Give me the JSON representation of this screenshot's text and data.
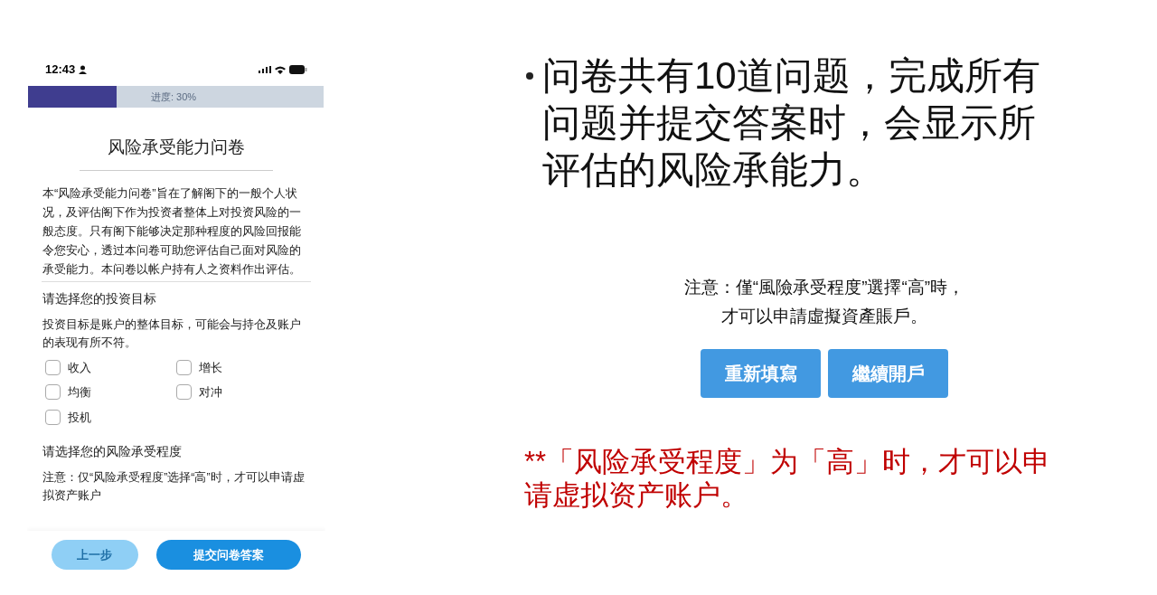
{
  "phone": {
    "status_bar": {
      "time": "12:43"
    },
    "progress": {
      "level": 0.3,
      "label": "进度: 30%"
    },
    "title": "风险承受能力问卷",
    "intro": "本“风险承受能力问卷”旨在了解阁下的一般个人状况，及评估阁下作为投资者整体上对投资风险的一般态度。只有阁下能够决定那种程度的风险回报能令您安心，透过本问卷可助您评估自己面对风险的承受能力。本问卷以帐户持有人之资料作出评估。",
    "sections": [
      {
        "heading": "请选择您的投资目标",
        "description": "投资目标是账户的整体目标，可能会与持仓及账户的表现有所不符。",
        "options": [
          {
            "label": "收入",
            "checked": false
          },
          {
            "label": "增长",
            "checked": false
          },
          {
            "label": "均衡",
            "checked": false
          },
          {
            "label": "对冲",
            "checked": false
          },
          {
            "label": "投机",
            "checked": false
          }
        ]
      },
      {
        "heading": "请选择您的风险承受程度",
        "description": "注意：仅“风险承受程度”选择“高”时，才可以申请虚拟资产账户"
      }
    ],
    "buttons": [
      {
        "label": "上一步",
        "disabled": true
      },
      {
        "label": "提交问卷答案",
        "disabled": false
      }
    ]
  },
  "slide": {
    "bullet": "问卷共有10道问题，完成所有问题并提交答案时，会显示所评估的风险承能力。",
    "notice_lines": [
      "注意：僅“風險承受程度”選擇“高”時，",
      "才可以申請虛擬資產賬戶。"
    ],
    "buttons": [
      "重新填寫",
      "繼續開戶"
    ],
    "remark": "**「风险承受程度」为「高」时，才可以申请虚拟资产账户。"
  }
}
